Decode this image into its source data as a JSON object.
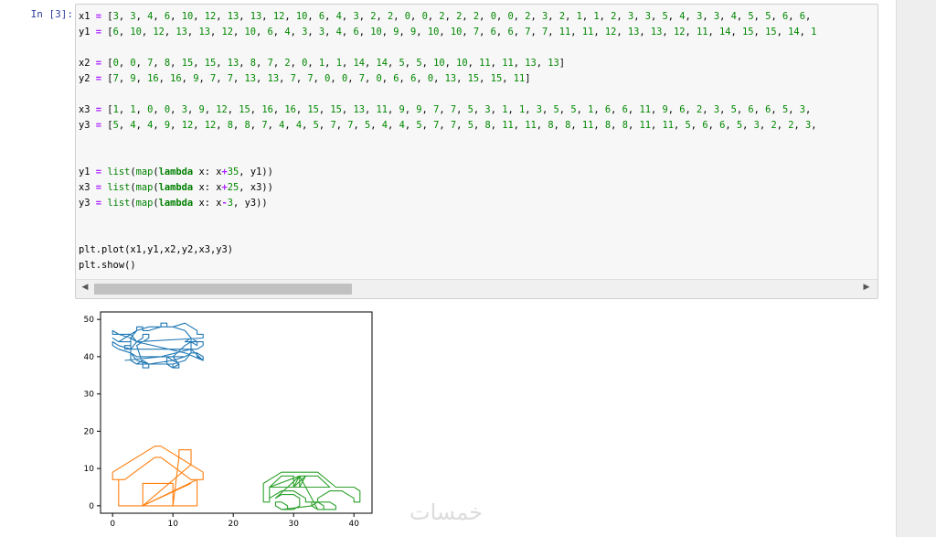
{
  "cell": {
    "prompt": "In [3]:",
    "code_lines": [
      "x1 = [3, 3, 4, 6, 10, 12, 13, 13, 12, 10, 6, 4, 3, 2, 2, 0, 0, 2, 2, 2, 0, 0, 2, 3, 2, 1, 1, 2, 3, 3, 5, 4, 3, 3, 4, 5, 5, 6, 6,",
      "y1 = [6, 10, 12, 13, 13, 12, 10, 6, 4, 3, 3, 4, 6, 10, 9, 9, 10, 10, 7, 6, 6, 7, 7, 11, 11, 12, 13, 13, 12, 11, 14, 15, 15, 14, 1",
      "",
      "x2 = [0, 0, 7, 8, 15, 15, 13, 8, 7, 2, 0, 1, 1, 14, 14, 5, 5, 10, 10, 11, 11, 13, 13]",
      "y2 = [7, 9, 16, 16, 9, 7, 7, 13, 13, 7, 7, 0, 0, 7, 0, 6, 6, 0, 13, 15, 15, 11]",
      "",
      "x3 = [1, 1, 0, 0, 3, 9, 12, 15, 16, 16, 15, 15, 13, 11, 9, 9, 7, 7, 5, 3, 1, 1, 3, 5, 5, 1, 6, 6, 11, 9, 6, 2, 3, 5, 6, 6, 5, 3,",
      "y3 = [5, 4, 4, 9, 12, 12, 8, 8, 7, 4, 4, 5, 7, 7, 5, 4, 4, 5, 7, 7, 5, 8, 11, 11, 8, 8, 11, 8, 8, 11, 11, 5, 6, 6, 5, 3, 2, 2, 3,",
      "",
      "",
      "y1 = list(map(lambda x: x+35, y1))",
      "x3 = list(map(lambda x: x+25, x3))",
      "y3 = list(map(lambda x: x-3, y3))",
      "",
      "",
      "plt.plot(x1,y1,x2,y2,x3,y3)",
      "plt.show()"
    ]
  },
  "scrollbar": {
    "left_arrow": "◀",
    "right_arrow": "▶"
  },
  "chart_data": {
    "type": "line",
    "xlim": [
      -2,
      43
    ],
    "ylim": [
      -2,
      52
    ],
    "xticks": [
      "0",
      "10",
      "20",
      "30",
      "40"
    ],
    "yticks": [
      "0",
      "10",
      "20",
      "30",
      "40",
      "50"
    ],
    "grid": false,
    "series": [
      {
        "color": "#1f77b4",
        "x": [
          3,
          3,
          4,
          6,
          10,
          12,
          13,
          13,
          12,
          10,
          6,
          4,
          3,
          3,
          1,
          0,
          0,
          1,
          3,
          4,
          6,
          10,
          12,
          13,
          14,
          14,
          15,
          15,
          14,
          13,
          12,
          10,
          6,
          4,
          3,
          3,
          4,
          3,
          1,
          0,
          0,
          1,
          3,
          4,
          5,
          5,
          6,
          6,
          5,
          4,
          5,
          5,
          6,
          6,
          5,
          4,
          10,
          10,
          11,
          11,
          10,
          9,
          9,
          10,
          10,
          11,
          11,
          10,
          12,
          13,
          14,
          14,
          13,
          12,
          15,
          15,
          14,
          13,
          2,
          2,
          3,
          3,
          2,
          1,
          0,
          0,
          1,
          4,
          4,
          5,
          5,
          6,
          8,
          8,
          9,
          9,
          10,
          12,
          12,
          13,
          13,
          14,
          14,
          15,
          15,
          4,
          12,
          15,
          13,
          8,
          2
        ],
        "y": [
          41,
          45,
          47,
          48,
          48,
          47,
          45,
          41,
          39,
          38,
          38,
          39,
          41,
          42,
          43,
          44,
          43,
          42,
          41,
          40,
          40,
          40,
          40,
          41,
          41,
          40,
          39,
          40,
          41,
          41,
          40,
          39,
          38,
          38,
          39,
          42,
          44,
          46,
          46,
          47,
          46,
          46,
          45,
          44,
          45,
          46,
          46,
          45,
          44,
          43,
          38,
          37,
          37,
          38,
          39,
          38,
          38,
          37,
          37,
          38,
          39,
          40,
          38,
          37,
          37,
          38,
          38,
          40,
          43,
          44,
          43,
          44,
          45,
          44,
          44,
          43,
          42,
          42,
          42,
          43,
          43,
          44,
          44,
          44,
          45,
          45,
          44,
          47,
          48,
          48,
          47,
          47,
          48,
          49,
          49,
          48,
          48,
          49,
          49,
          48,
          48,
          47,
          46,
          46,
          45,
          44,
          41,
          39,
          42,
          40,
          39
        ]
      },
      {
        "color": "#ff7f0e",
        "x": [
          0,
          0,
          7,
          8,
          15,
          15,
          13,
          8,
          7,
          2,
          0,
          1,
          1,
          14,
          14,
          5,
          5,
          10,
          10,
          11,
          11,
          13,
          13,
          5,
          13
        ],
        "y": [
          7,
          9,
          16,
          16,
          9,
          7,
          7,
          13,
          13,
          7,
          7,
          7,
          0,
          0,
          7,
          0,
          6,
          6,
          0,
          13,
          15,
          15,
          11,
          0,
          6
        ]
      },
      {
        "color": "#2ca02c",
        "x": [
          26,
          26,
          25,
          25,
          28,
          34,
          37,
          40,
          41,
          41,
          40,
          40,
          38,
          36,
          34,
          34,
          32,
          32,
          30,
          28,
          26,
          26,
          28,
          30,
          30,
          26,
          31,
          31,
          36,
          34,
          31,
          27,
          28,
          30,
          31,
          31,
          30,
          28,
          27,
          27,
          28,
          29,
          29,
          28,
          33,
          34,
          36,
          37,
          37,
          36,
          34,
          33,
          33,
          34,
          35,
          35,
          34,
          31,
          30,
          31,
          32,
          30
        ],
        "y": [
          2,
          1,
          1,
          6,
          9,
          9,
          5,
          5,
          4,
          1,
          1,
          2,
          4,
          4,
          2,
          1,
          1,
          2,
          4,
          4,
          2,
          5,
          8,
          8,
          5,
          5,
          8,
          5,
          5,
          8,
          8,
          2,
          3,
          3,
          2,
          0,
          -1,
          -1,
          0,
          1,
          1,
          0,
          -1,
          -1,
          0,
          1,
          1,
          0,
          -1,
          -1,
          -1,
          0,
          1,
          1,
          0,
          -1,
          -1,
          8,
          5,
          5,
          8,
          5
        ]
      }
    ]
  },
  "watermark": "خمسات"
}
